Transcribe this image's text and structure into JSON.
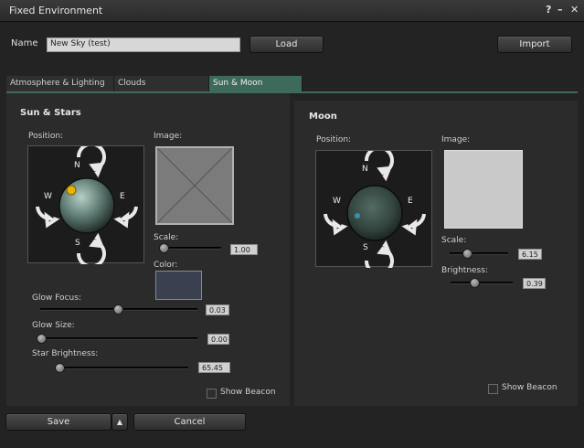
{
  "window": {
    "title": "Fixed Environment",
    "help_icon": "?",
    "min_icon": "–",
    "close_icon": "✕"
  },
  "name": {
    "label": "Name",
    "value": "New Sky (test)"
  },
  "buttons": {
    "load": "Load",
    "import": "Import",
    "save": "Save",
    "save_menu": "▲",
    "cancel": "Cancel"
  },
  "tabs": [
    {
      "label": "Atmosphere & Lighting",
      "active": false
    },
    {
      "label": "Clouds",
      "active": false
    },
    {
      "label": "Sun & Moon",
      "active": true
    }
  ],
  "sun": {
    "section_title": "Sun & Stars",
    "position_label": "Position:",
    "compass": {
      "n": "N",
      "s": "S",
      "e": "E",
      "w": "W"
    },
    "image_label": "Image:",
    "scale_label": "Scale:",
    "scale_value": "1.00",
    "color_label": "Color:",
    "color": "#3a4050",
    "glow_focus_label": "Glow Focus:",
    "glow_focus_value": "0.03",
    "glow_size_label": "Glow Size:",
    "glow_size_value": "0.00",
    "star_brightness_label": "Star Brightness:",
    "star_brightness_value": "65.45",
    "show_beacon_label": "Show Beacon"
  },
  "moon": {
    "section_title": "Moon",
    "position_label": "Position:",
    "compass": {
      "n": "N",
      "s": "S",
      "e": "E",
      "w": "W"
    },
    "image_label": "Image:",
    "scale_label": "Scale:",
    "scale_value": "6.15",
    "brightness_label": "Brightness:",
    "brightness_value": "0.39",
    "show_beacon_label": "Show Beacon"
  },
  "colors": {
    "accent_tab": "#3e6a5c",
    "sun_dot": "#e8b400",
    "moon_dot": "#3a8fb0"
  }
}
